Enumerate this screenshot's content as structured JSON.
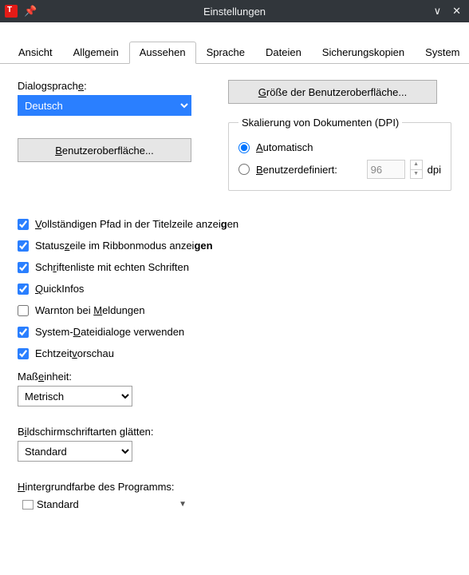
{
  "window": {
    "title": "Einstellungen"
  },
  "tabs": {
    "items": [
      "Ansicht",
      "Allgemein",
      "Aussehen",
      "Sprache",
      "Dateien",
      "Sicherungskopien",
      "System"
    ],
    "active_index": 2,
    "overflow_glyph": "⇥"
  },
  "dialog_lang": {
    "label_pre": "Dialogsprach",
    "label_u": "e",
    "label_post": ":",
    "value": "Deutsch"
  },
  "ui_button": {
    "pre": "",
    "u": "B",
    "post": "enutzeroberfläche..."
  },
  "ui_size_button": {
    "pre": "",
    "u": "G",
    "post": "röße der Benutzeroberfläche..."
  },
  "dpi": {
    "legend": "Skalierung von Dokumenten (DPI)",
    "auto": {
      "u": "A",
      "post": "utomatisch"
    },
    "custom": {
      "u": "B",
      "post": "enutzerdefiniert:"
    },
    "value": "96",
    "unit": "dpi",
    "selected": "auto"
  },
  "checks": {
    "fullpath": {
      "checked": true,
      "pre": "",
      "u": "V",
      "mid": "ollständigen Pfad in der Titelzeile anzei",
      "bold": "g",
      "post": "en"
    },
    "statusbar": {
      "checked": true,
      "pre": "Status",
      "u": "z",
      "mid": "eile im Ribbonmodus anzei",
      "bold": "gen",
      "post": ""
    },
    "realfonts": {
      "checked": true,
      "pre": "Sch",
      "u": "r",
      "mid": "iftenliste mit echten Schriften",
      "bold": "",
      "post": ""
    },
    "quickinfo": {
      "checked": true,
      "pre": "",
      "u": "Q",
      "mid": "uickInfos",
      "bold": "",
      "post": ""
    },
    "beep": {
      "checked": false,
      "pre": "Warnton bei ",
      "u": "M",
      "mid": "eldungen",
      "bold": "",
      "post": ""
    },
    "sysdialogs": {
      "checked": true,
      "pre": "System-",
      "u": "D",
      "mid": "ateidialoge verwenden",
      "bold": "",
      "post": ""
    },
    "livepreview": {
      "checked": true,
      "pre": "Echtzeit",
      "u": "v",
      "mid": "orschau",
      "bold": "",
      "post": ""
    }
  },
  "unit": {
    "label_pre": "Maß",
    "label_u": "e",
    "label_post": "inheit:",
    "value": "Metrisch"
  },
  "smoothing": {
    "label_pre": "B",
    "label_u": "i",
    "label_post": "ldschirmschriftarten glätten:",
    "value": "Standard"
  },
  "bgcolor": {
    "label_u": "H",
    "label_post": "intergrundfarbe des Programms:",
    "value": "Standard"
  }
}
